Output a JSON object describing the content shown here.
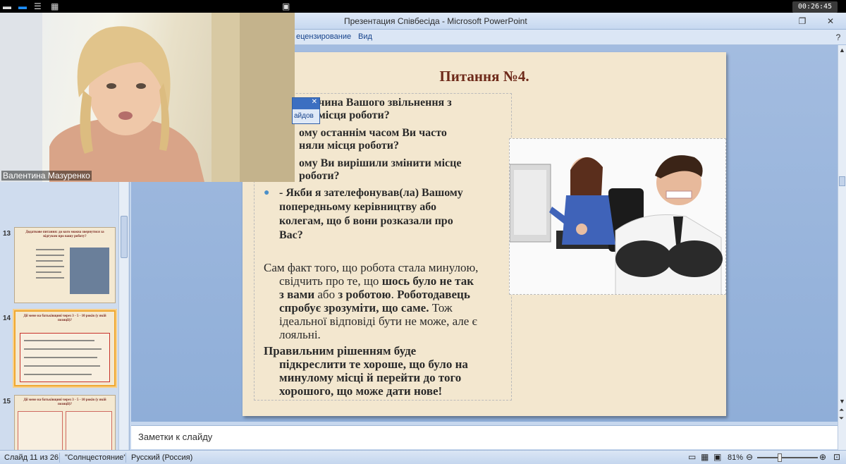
{
  "app_title": "Презентация Співбесіда - Microsoft PowerPoint",
  "timer": "00:26:45",
  "ribbon_tabs": [
    "ецензирование",
    "Вид"
  ],
  "video": {
    "participant_name": "Валентина Мазуренко",
    "popup_label": "айдов"
  },
  "thumbnails": {
    "items": [
      {
        "num": "13",
        "title": "Додаткове питання: до кого можна звернутися за відгуком про вашу роботу?"
      },
      {
        "num": "14",
        "title": "Дії мене на батьківщині через 3 - 5 - 10 років (у якій позиції)?"
      },
      {
        "num": "15",
        "title": "Дії мене на батьківщині через 3 - 5 - 10 років (у якій позиції)?"
      }
    ]
  },
  "slide": {
    "title": "Питання №4.",
    "questions": [
      "причина Вашого звільнення з",
      "ого місця роботи?",
      "ому останнім часом Ви часто",
      "няли місця роботи?",
      "ому Ви вирішили змінити місце",
      "роботи?"
    ],
    "bullet_question": [
      "- Якби я зателефонував(ла) Вашому",
      "попередньому керівництву або",
      "колегам, що б вони розказали про",
      "Вас?"
    ],
    "para1": {
      "line1": "Сам факт того, що робота стала минулою,",
      "line2": "свідчить про те, що ",
      "line2_bold": "шось було не так",
      "line3_bold": "з вами",
      "line3": " або ",
      "line3_bold2": "з роботою",
      "line3_end": ". ",
      "line3_bold3": "Роботодавець",
      "line4_bold": "спробує зрозуміти, що саме.",
      "line4": " Тож",
      "line5": "ідеальної відповіді бути не може, але є",
      "line6": "лояльні."
    },
    "para2": [
      "Правильним рішенням буде",
      "підкреслити те хороше, що було на",
      "минулому місці й перейти до того",
      "хорошого, що може дати нове!"
    ]
  },
  "notes_label": "Заметки к слайду",
  "status": {
    "slide_info": "Слайд 11 из 26",
    "theme": "\"Солнцестояние\"",
    "language": "Русский (Россия)",
    "zoom": "81%"
  }
}
